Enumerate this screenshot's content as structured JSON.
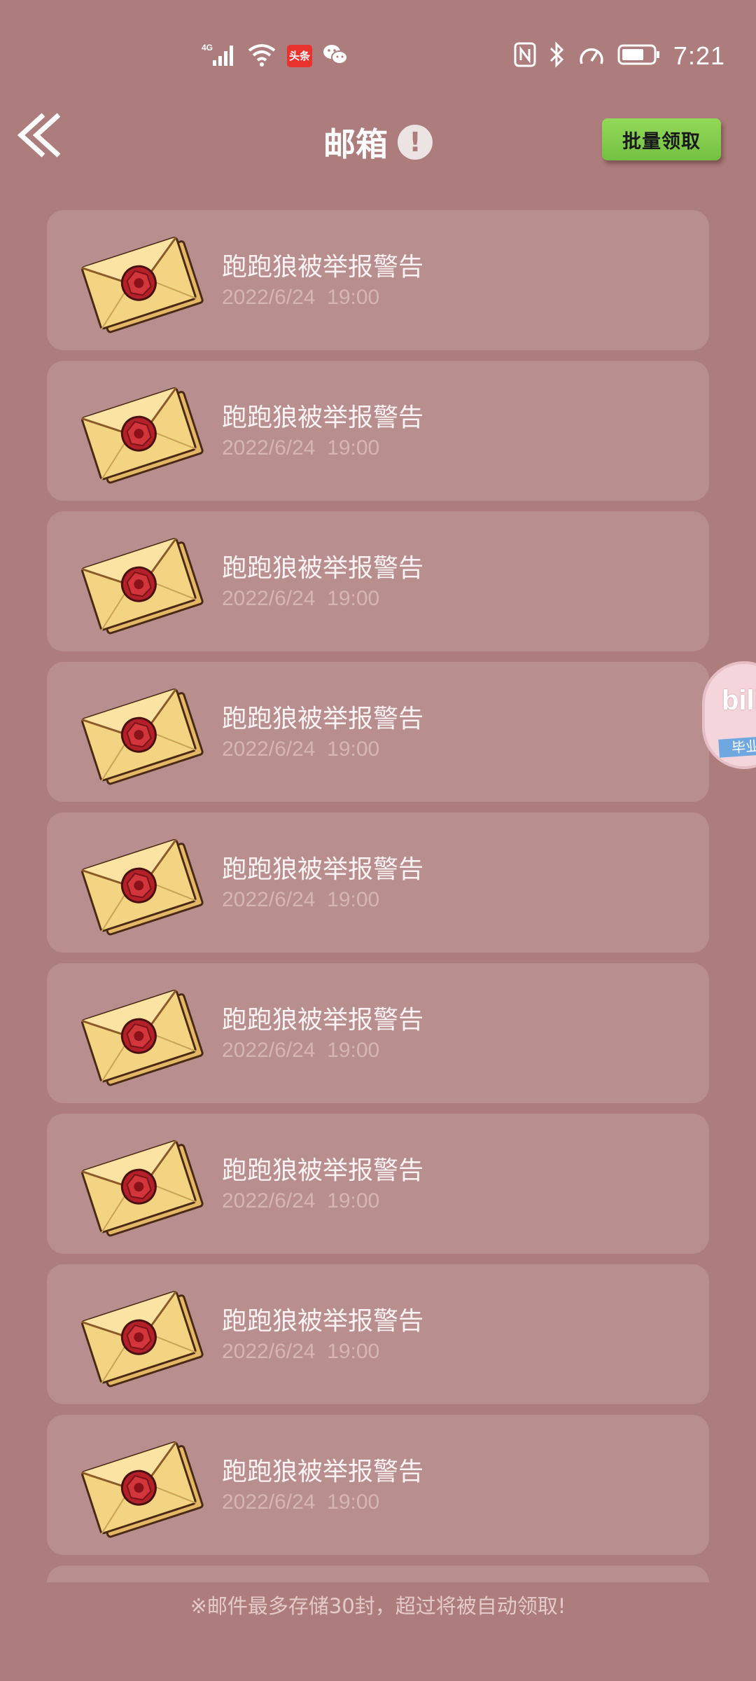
{
  "status_bar": {
    "network_label": "4G",
    "news_app_badge": "头条",
    "time": "7:21",
    "icons": [
      "signal-icon",
      "wifi-icon",
      "toutiao-icon",
      "wechat-icon",
      "nfc-icon",
      "bluetooth-icon",
      "speed-icon",
      "battery-icon"
    ]
  },
  "header": {
    "title": "邮箱",
    "info_icon_glyph": "!",
    "batch_claim_label": "批量领取"
  },
  "mails": [
    {
      "title": "跑跑狼被举报警告",
      "date": "2022/6/24",
      "time": "19:00"
    },
    {
      "title": "跑跑狼被举报警告",
      "date": "2022/6/24",
      "time": "19:00"
    },
    {
      "title": "跑跑狼被举报警告",
      "date": "2022/6/24",
      "time": "19:00"
    },
    {
      "title": "跑跑狼被举报警告",
      "date": "2022/6/24",
      "time": "19:00"
    },
    {
      "title": "跑跑狼被举报警告",
      "date": "2022/6/24",
      "time": "19:00"
    },
    {
      "title": "跑跑狼被举报警告",
      "date": "2022/6/24",
      "time": "19:00"
    },
    {
      "title": "跑跑狼被举报警告",
      "date": "2022/6/24",
      "time": "19:00"
    },
    {
      "title": "跑跑狼被举报警告",
      "date": "2022/6/24",
      "time": "19:00"
    },
    {
      "title": "跑跑狼被举报警告",
      "date": "2022/6/24",
      "time": "19:00"
    }
  ],
  "floating_widget": {
    "text": "bili",
    "ribbon": "毕业"
  },
  "footer": {
    "notice": "※邮件最多存储30封，超过将被自动领取!"
  },
  "colors": {
    "background": "#ad7c7c",
    "batch_button": "#7cc84a",
    "envelope_paper": "#f0cd7a",
    "wax_seal": "#b3202a"
  }
}
